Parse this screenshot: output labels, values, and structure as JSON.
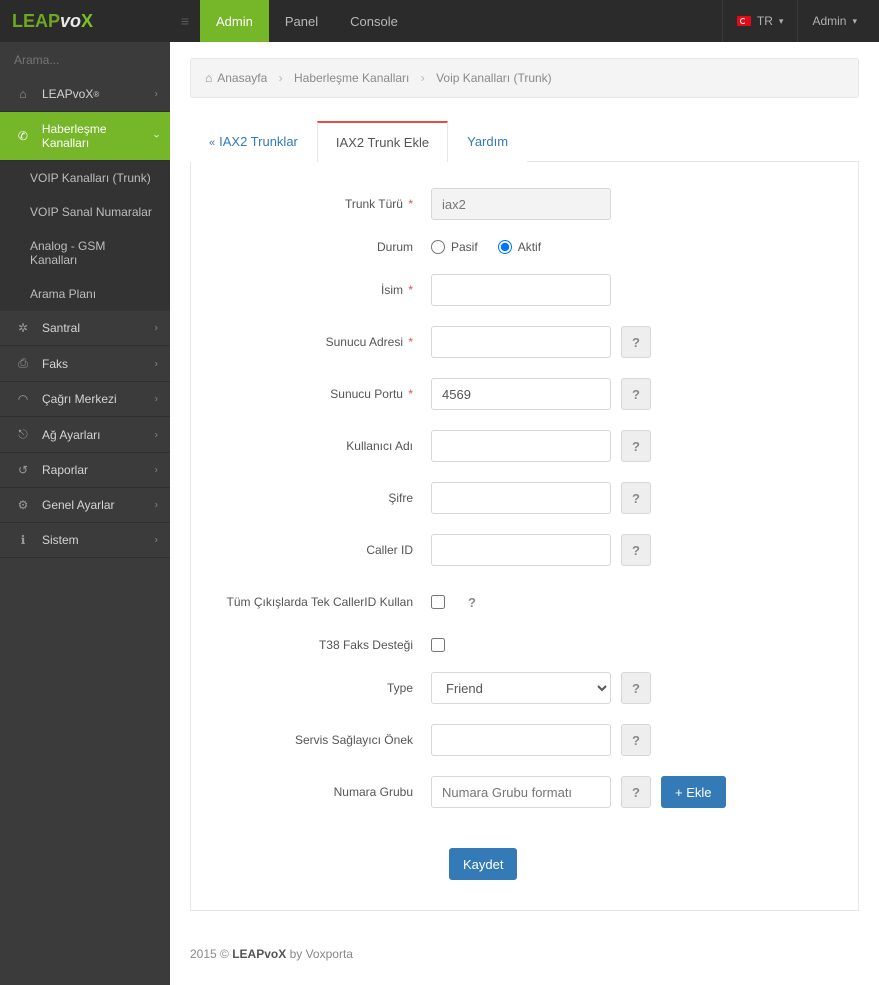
{
  "topbar": {
    "logo_leap": "LEAP",
    "logo_vo": "vo",
    "logo_x": "X",
    "nav": {
      "admin": "Admin",
      "panel": "Panel",
      "console": "Console"
    },
    "lang_code": "TR",
    "user_label": "Admin"
  },
  "sidebar": {
    "search_placeholder": "Arama...",
    "items": [
      {
        "icon": "⌂",
        "label": "LEAPvoX",
        "sup": "®"
      },
      {
        "icon": "✆",
        "label": "Haberleşme Kanalları",
        "active": true
      },
      {
        "sub": true,
        "label": "VOIP Kanalları (Trunk)"
      },
      {
        "sub": true,
        "label": "VOIP Sanal Numaralar"
      },
      {
        "sub": true,
        "label": "Analog - GSM Kanalları"
      },
      {
        "sub": true,
        "label": "Arama Planı"
      },
      {
        "icon": "✲",
        "label": "Santral"
      },
      {
        "icon": "⎙",
        "label": "Faks"
      },
      {
        "icon": "◠",
        "label": "Çağrı Merkezi"
      },
      {
        "icon": "⎋",
        "label": "Ağ Ayarları"
      },
      {
        "icon": "↺",
        "label": "Raporlar"
      },
      {
        "icon": "⚙",
        "label": "Genel Ayarlar"
      },
      {
        "icon": "ℹ",
        "label": "Sistem"
      }
    ]
  },
  "breadcrumb": {
    "home": "Anasayfa",
    "mid": "Haberleşme Kanalları",
    "current": "Voip Kanalları (Trunk)"
  },
  "tabs": {
    "list": "IAX2 Trunklar",
    "add": "IAX2 Trunk Ekle",
    "help": "Yardım"
  },
  "form": {
    "trunk_type_label": "Trunk Türü",
    "trunk_type_value": "iax2",
    "status_label": "Durum",
    "status_passive": "Pasif",
    "status_active": "Aktif",
    "name_label": "İsim",
    "server_addr_label": "Sunucu Adresi",
    "server_port_label": "Sunucu Portu",
    "server_port_value": "4569",
    "username_label": "Kullanıcı Adı",
    "password_label": "Şifre",
    "callerid_label": "Caller ID",
    "single_callerid_label": "Tüm Çıkışlarda Tek CallerID Kullan",
    "t38_label": "T38 Faks Desteği",
    "type_label": "Type",
    "type_value": "Friend",
    "prefix_label": "Servis Sağlayıcı Önek",
    "number_group_label": "Numara Grubu",
    "number_group_placeholder": "Numara Grubu formatı",
    "add_btn": "Ekle",
    "save_btn": "Kaydet"
  },
  "footer": {
    "year": "2015 ©",
    "brand": "LEAPvoX",
    "by": "by Voxporta"
  },
  "icons": {
    "home": "⌂",
    "help": "?",
    "plus": "+",
    "dbl_left": "«"
  }
}
